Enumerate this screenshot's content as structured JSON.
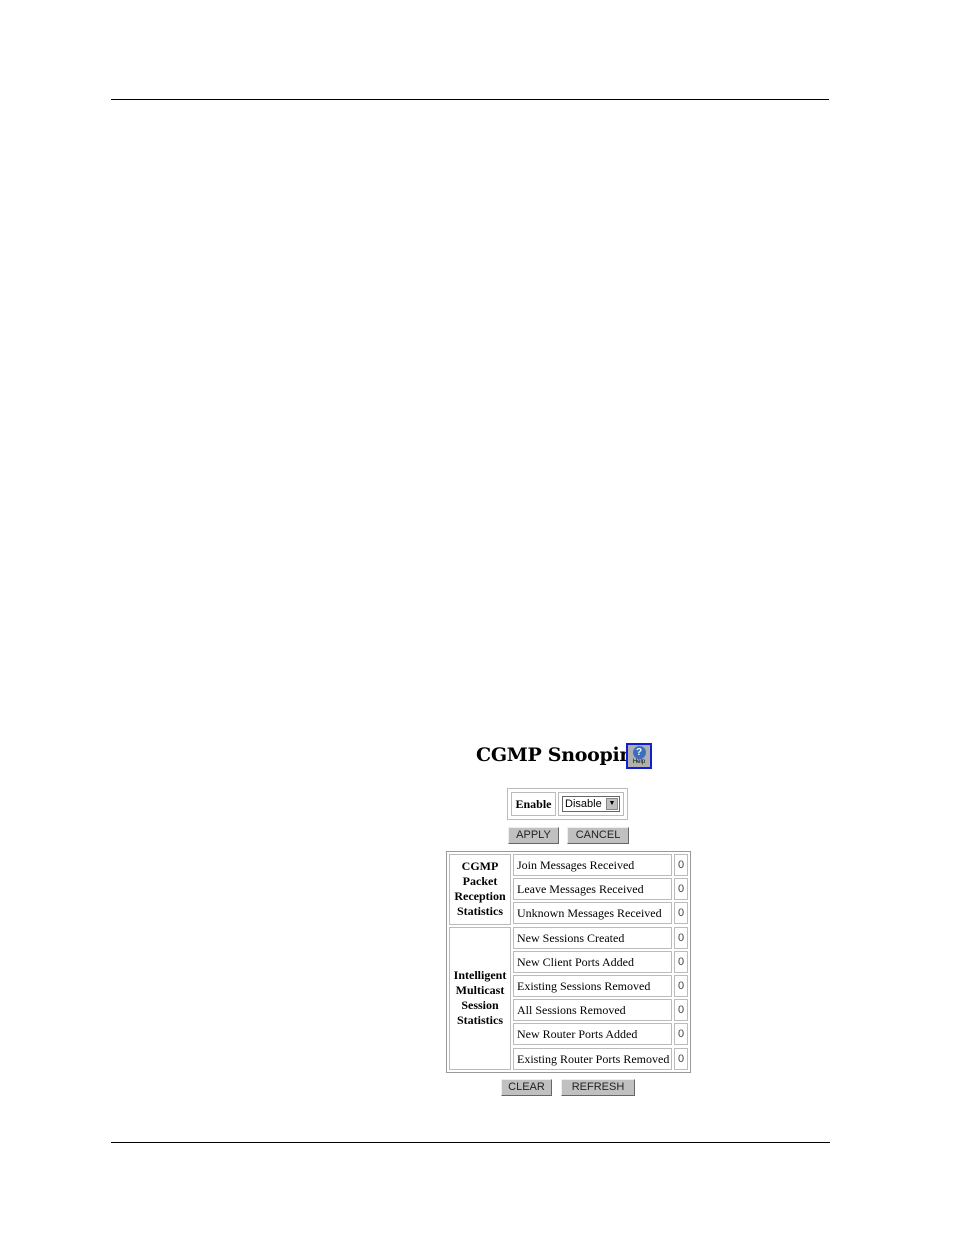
{
  "page": {
    "title": "CGMP Snooping",
    "help_label": "Help",
    "help_icon": "question-mark-icon",
    "enable": {
      "label": "Enable",
      "selected": "Disable"
    },
    "buttons": {
      "apply": "APPLY",
      "cancel": "CANCEL",
      "clear": "CLEAR",
      "refresh": "REFRESH"
    },
    "groups": [
      {
        "label": "CGMP Packet Reception Statistics",
        "rows": [
          {
            "name": "Join Messages Received",
            "value": "0"
          },
          {
            "name": "Leave Messages Received",
            "value": "0"
          },
          {
            "name": "Unknown Messages Received",
            "value": "0"
          }
        ]
      },
      {
        "label": "Intelligent Multicast Session Statistics",
        "rows": [
          {
            "name": "New Sessions Created",
            "value": "0"
          },
          {
            "name": "New Client Ports Added",
            "value": "0"
          },
          {
            "name": "Existing Sessions Removed",
            "value": "0"
          },
          {
            "name": "All Sessions Removed",
            "value": "0"
          },
          {
            "name": "New Router Ports Added",
            "value": "0"
          },
          {
            "name": "Existing Router Ports Removed",
            "value": "0"
          }
        ]
      }
    ]
  }
}
